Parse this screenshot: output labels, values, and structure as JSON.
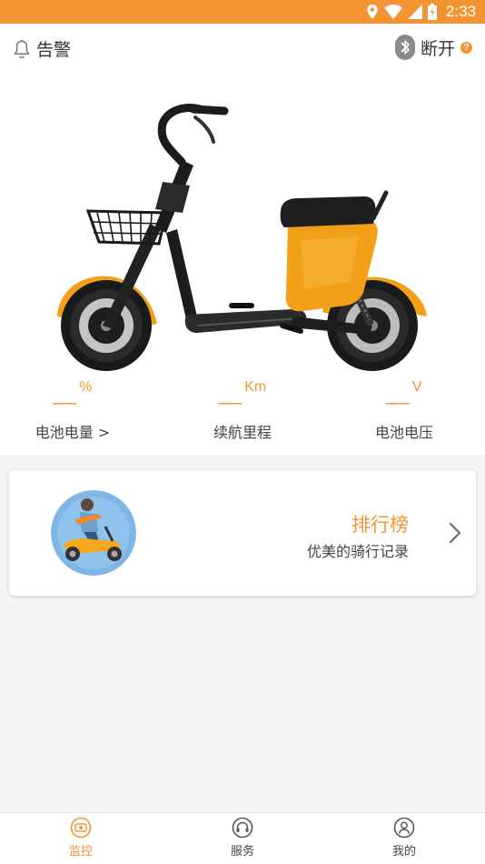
{
  "colors": {
    "accent": "#f39433",
    "text": "#333333",
    "muted": "#444444"
  },
  "status_bar": {
    "time": "2:33",
    "icons": [
      "location-icon",
      "wifi-icon",
      "signal-icon",
      "battery-icon"
    ]
  },
  "header": {
    "alarm": {
      "icon": "bell-icon",
      "label": "告警"
    },
    "bluetooth": {
      "icon": "bluetooth-icon",
      "label": "断开",
      "help": "?"
    }
  },
  "stats": [
    {
      "value": "__",
      "unit": "%",
      "label": "电池电量 >"
    },
    {
      "value": "__",
      "unit": "Km",
      "label": "续航里程"
    },
    {
      "value": "__",
      "unit": "V",
      "label": "电池电压"
    }
  ],
  "ranking": {
    "title": "排行榜",
    "subtitle": "优美的骑行记录"
  },
  "tabs": [
    {
      "label": "监控",
      "icon": "monitor-icon",
      "active": true
    },
    {
      "label": "服务",
      "icon": "headset-icon",
      "active": false
    },
    {
      "label": "我的",
      "icon": "profile-icon",
      "active": false
    }
  ]
}
